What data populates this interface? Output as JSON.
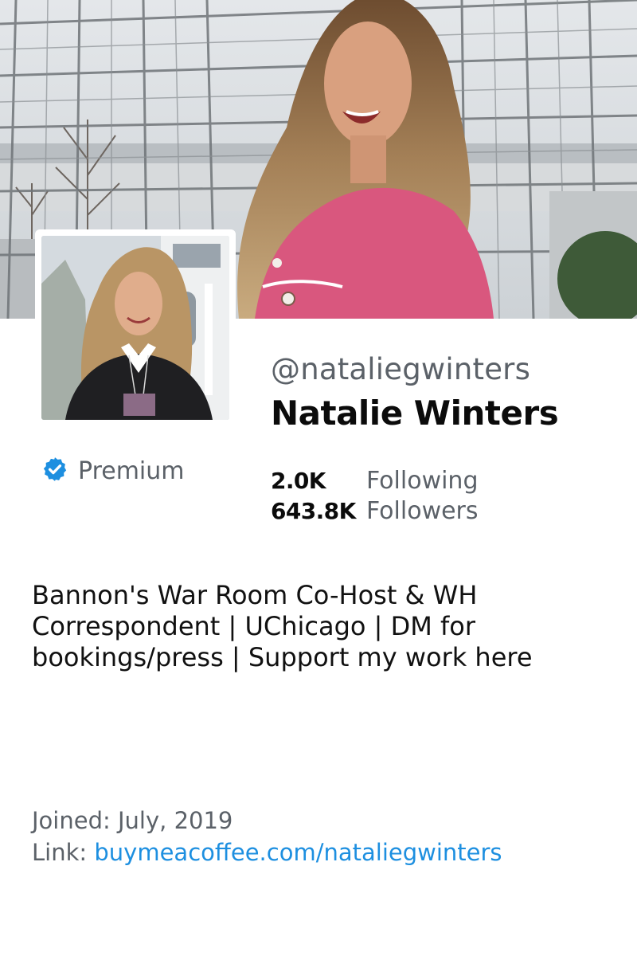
{
  "profile": {
    "handle": "@nataliegwinters",
    "display_name": "Natalie Winters",
    "badge_label": "Premium",
    "badge_icon": "verified-badge-icon",
    "accent_color": "#1d8fe0"
  },
  "stats": {
    "following_count": "2.0K",
    "following_label": "Following",
    "followers_count": "643.8K",
    "followers_label": "Followers"
  },
  "bio": "Bannon's War Room Co-Host & WH Correspondent | UChicago | DM for bookings/press | Support my work here",
  "meta": {
    "joined_label": "Joined:",
    "joined_value": "July, 2019",
    "link_label": "Link:",
    "link_value": "buymeacoffee.com/nataliegwinters"
  }
}
